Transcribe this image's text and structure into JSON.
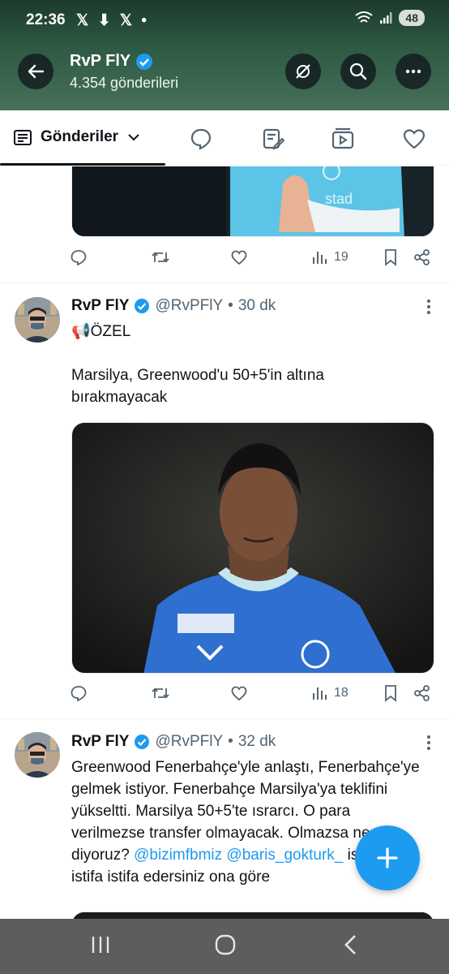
{
  "status_bar": {
    "time": "22:36",
    "notif_icons": "𝕏 ⬇ 𝕏 •",
    "battery": "48"
  },
  "header": {
    "title": "RvP FlY",
    "subtitle": "4.354 gönderileri"
  },
  "tabs": {
    "active_label": "Gönderiler"
  },
  "tweets": [
    {
      "views": "19"
    },
    {
      "name": "RvP FlY",
      "handle": "@RvPFlY",
      "sep": "•",
      "time": "30 dk",
      "line1": "📢ÖZEL",
      "line2": "Marsilya, Greenwood'u 50+5'in altına bırakmayacak",
      "views": "18"
    },
    {
      "name": "RvP FlY",
      "handle": "@RvPFlY",
      "sep": "•",
      "time": "32 dk",
      "text": "Greenwood Fenerbahçe'yle anlaştı, Fenerbahçe'ye gelmek istiyor. Fenerbahçe Marsilya'ya teklifini yükseltti. Marsilya 50+5'te ısrarcı. O para verilmezse transfer olmayacak. Olmazsa ne diyoruz?",
      "mention1": "@bizimfbmiz",
      "mention2": "@baris_gokturk_",
      "text_end": " istifa ed istifa istifa edersiniz ona göre"
    }
  ],
  "colors": {
    "accent": "#1d9bf0",
    "verified": "#1d9bf0",
    "header_bg": "#2f5a43"
  }
}
